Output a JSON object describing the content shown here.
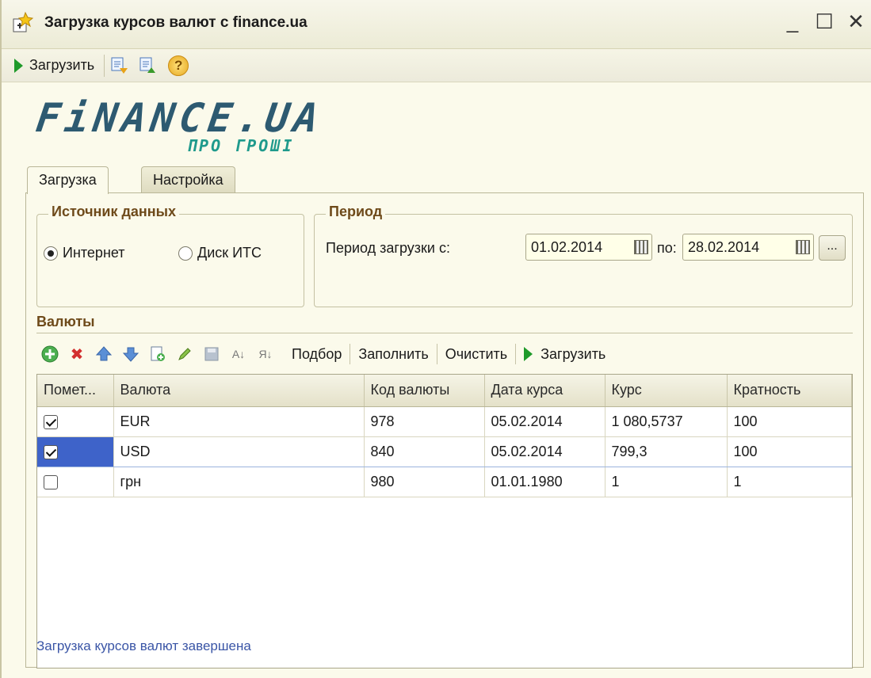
{
  "window": {
    "title": "Загрузка курсов валют с finance.ua",
    "minimize": "_",
    "maximize": "☐",
    "close": "✕"
  },
  "toolbar": {
    "load_label": "Загрузить",
    "help_glyph": "?"
  },
  "logo": {
    "main": "FiNANCE.UA",
    "sub": "ПРО ГРОШІ"
  },
  "tabs": [
    {
      "label": "Загрузка",
      "active": true
    },
    {
      "label": "Настройка",
      "active": false
    }
  ],
  "source_group": {
    "title": "Источник данных",
    "options": [
      {
        "label": "Интернет",
        "selected": true
      },
      {
        "label": "Диск ИТС",
        "selected": false
      }
    ]
  },
  "period_group": {
    "title": "Период",
    "from_label": "Период загрузки с:",
    "from_value": "01.02.2014",
    "to_label": "по:",
    "to_value": "28.02.2014",
    "more_button": "..."
  },
  "currencies_section": {
    "title": "Валюты",
    "buttons": {
      "select": "Подбор",
      "fill": "Заполнить",
      "clear": "Очистить",
      "load": "Загрузить"
    }
  },
  "table": {
    "columns": [
      "Помет...",
      "Валюта",
      "Код валюты",
      "Дата курса",
      "Курс",
      "Кратность"
    ],
    "rows": [
      {
        "checked": true,
        "currency": "EUR",
        "code": "978",
        "date": "05.02.2014",
        "rate": "1 080,5737",
        "multiplicity": "100"
      },
      {
        "checked": true,
        "currency": "USD",
        "code": "840",
        "date": "05.02.2014",
        "rate": "799,3",
        "multiplicity": "100"
      },
      {
        "checked": false,
        "currency": "грн",
        "code": "980",
        "date": "01.01.1980",
        "rate": "1",
        "multiplicity": "1"
      }
    ]
  },
  "status": "Загрузка курсов валют завершена",
  "colors": {
    "window_bg": "#fbfaeb",
    "group_title": "#6e4a1a",
    "selection": "#3e63c9",
    "status_text": "#3a55a6",
    "play_green": "#1f9a2a"
  }
}
